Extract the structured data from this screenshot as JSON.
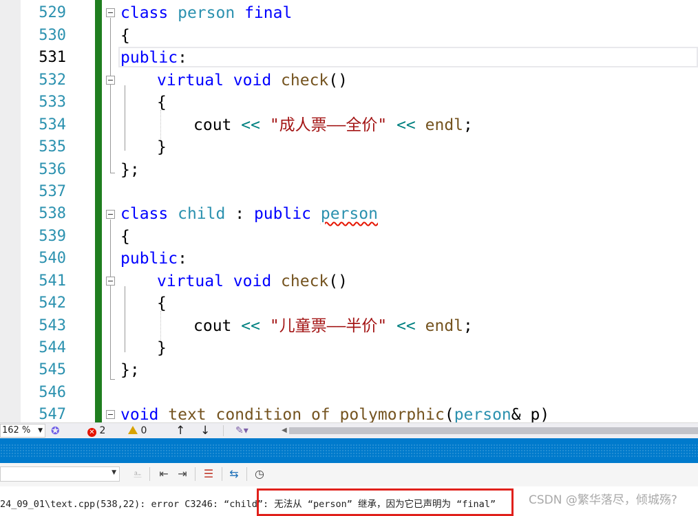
{
  "editor": {
    "line_numbers": [
      "529",
      "530",
      "531",
      "532",
      "533",
      "534",
      "535",
      "536",
      "537",
      "538",
      "539",
      "540",
      "541",
      "542",
      "543",
      "544",
      "545",
      "546",
      "547"
    ],
    "current_line": "531",
    "code": {
      "l529": {
        "kw1": "class",
        "ty": "person",
        "kw2": "final"
      },
      "l530": {
        "text": "{"
      },
      "l531": {
        "kw": "public",
        "punct": ":"
      },
      "l532": {
        "kw1": "virtual",
        "kw2": "void",
        "fn": "check",
        "punct": "()"
      },
      "l533": {
        "text": "{"
      },
      "l534": {
        "id": "cout",
        "op1": "<<",
        "str": "\"成人票——全价\"",
        "op2": "<<",
        "id2": "endl",
        "punct": ";"
      },
      "l535": {
        "text": "}"
      },
      "l536": {
        "text": "};"
      },
      "l538": {
        "kw1": "class",
        "ty": "child",
        "colon": ":",
        "kw2": "public",
        "base": "person"
      },
      "l539": {
        "text": "{"
      },
      "l540": {
        "kw": "public",
        "punct": ":"
      },
      "l541": {
        "kw1": "virtual",
        "kw2": "void",
        "fn": "check",
        "punct": "()"
      },
      "l542": {
        "text": "{"
      },
      "l543": {
        "id": "cout",
        "op1": "<<",
        "str": "\"儿童票——半价\"",
        "op2": "<<",
        "id2": "endl",
        "punct": ";"
      },
      "l544": {
        "text": "}"
      },
      "l545": {
        "text": "};"
      },
      "l547": {
        "kw": "void",
        "fn": "text_condition_of_polymorphic",
        "paren": "(",
        "ty": "person",
        "amp": "&",
        "param": "p",
        "close": ")"
      }
    }
  },
  "statusbar": {
    "zoom": "162 %",
    "error_count": "2",
    "warning_count": "0"
  },
  "output": {
    "line_prefix": "24_09_01\\text.cpp(538,22): error C3246: “child”",
    "line_highlight": ": 无法从 “person” 继承，因为它已声明为 “final”",
    "watermark": "CSDN @繁华落尽，倾城殇?"
  },
  "colors": {
    "keyword": "#0000ff",
    "type": "#2b91af",
    "function": "#74531f",
    "string": "#a31515",
    "operator": "#008080",
    "change_bar": "#1f7e1f",
    "accent_blue": "#007acc",
    "error_box": "#e0201b"
  },
  "icons": [
    "error-icon",
    "warning-icon",
    "arrow-up-icon",
    "arrow-down-icon",
    "cleanup-icon",
    "health-icon",
    "clear-icon",
    "wrap-icon",
    "find-icon",
    "clock-icon"
  ]
}
